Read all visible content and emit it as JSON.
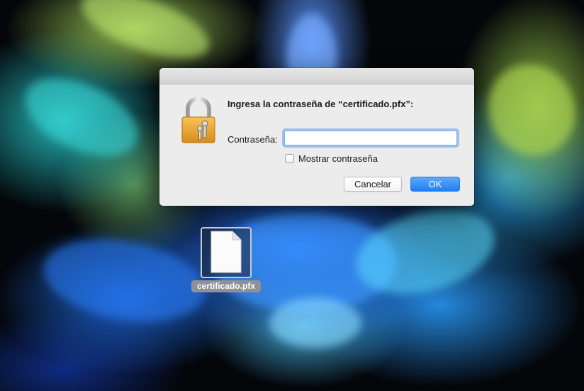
{
  "dialog": {
    "title": "Ingresa la contraseña de “certificado.pfx”:",
    "password_label": "Contraseña:",
    "password_value": "",
    "show_password_label": "Mostrar contraseña",
    "show_password_checked": false,
    "cancel_label": "Cancelar",
    "ok_label": "OK",
    "icon": "padlock-with-keys-icon"
  },
  "desktop": {
    "file": {
      "name": "certificado.pfx",
      "icon": "blank-document-icon",
      "selected": true
    }
  },
  "colors": {
    "accent": "#1d7ef3",
    "focus_ring": "#7fb0e9",
    "dialog_background": "#ececec"
  }
}
